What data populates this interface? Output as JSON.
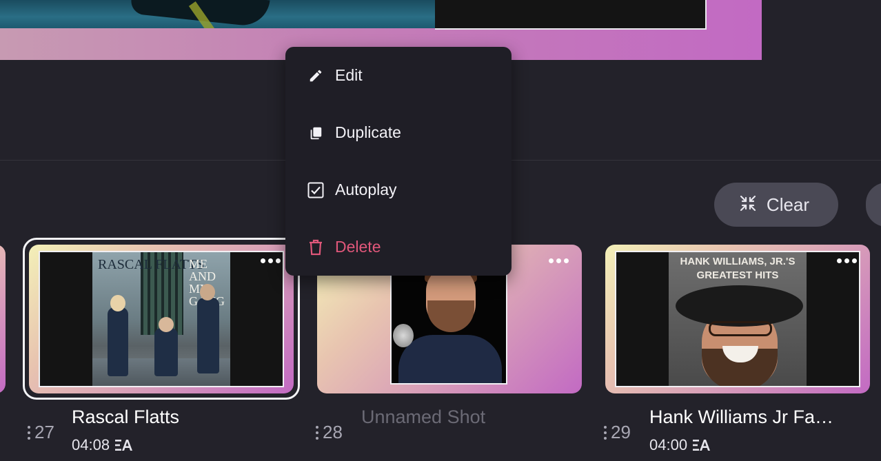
{
  "colors": {
    "background": "#23222a",
    "menu_background": "#1f1e26",
    "danger": "#e0577a",
    "muted_text": "#6b6a75",
    "pill_button": "#4a4955"
  },
  "context_menu": {
    "items": [
      {
        "label": "Edit",
        "icon": "pencil-icon"
      },
      {
        "label": "Duplicate",
        "icon": "duplicate-icon"
      },
      {
        "label": "Autoplay",
        "icon": "checkbox-checked-icon",
        "checked": true
      },
      {
        "label": "Delete",
        "icon": "trash-icon",
        "danger": true
      }
    ]
  },
  "toolbar": {
    "clear_label": "Clear",
    "clear_icon": "collapse-arrows-icon"
  },
  "shots": [
    {
      "index": "27",
      "title": "Rascal Flatts",
      "duration": "04:08",
      "autoplay_badge": "autoplay-icon",
      "selected": true,
      "album_text_left": "RASCAL FLATTS",
      "album_text_right": "ME AND MY GANG"
    },
    {
      "index": "28",
      "title": "Unnamed Shot",
      "duration": "",
      "selected": false
    },
    {
      "index": "29",
      "title": "Hank Williams Jr Fa…",
      "duration": "04:00",
      "autoplay_badge": "autoplay-icon",
      "selected": false,
      "album_text": "HANK WILLIAMS, JR.'S GREATEST HITS"
    }
  ]
}
